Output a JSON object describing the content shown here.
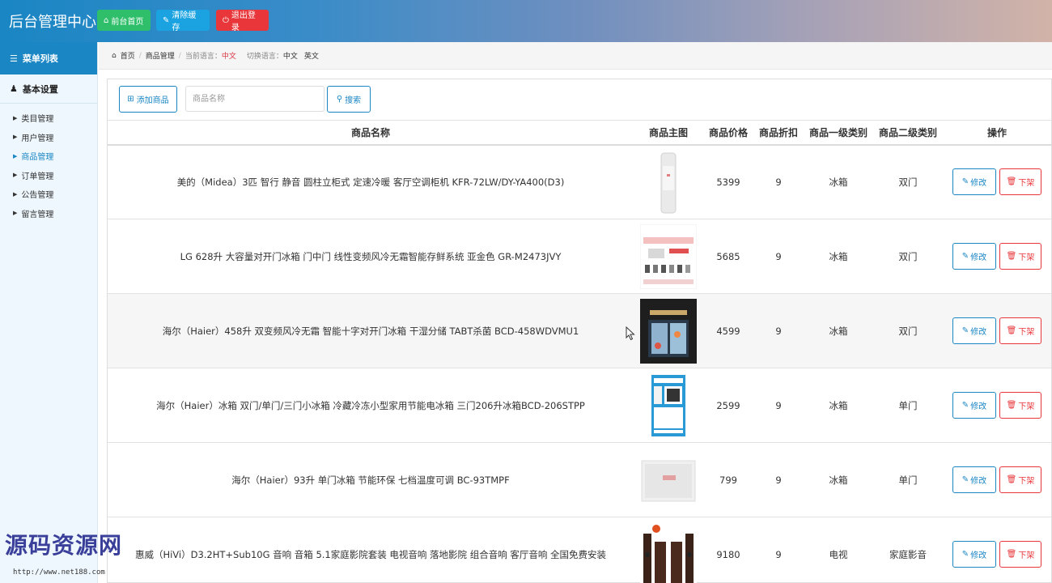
{
  "header": {
    "brand": "后台管理中心",
    "buttons": [
      {
        "icon": "home-icon",
        "label": "前台首页",
        "color": "#2fbf6b"
      },
      {
        "icon": "wrench-icon",
        "label": "清除缓存",
        "color": "#1aa3e0"
      },
      {
        "icon": "power-icon",
        "label": "退出登录",
        "color": "#e8363a"
      }
    ]
  },
  "sidebar": {
    "menu_title": "菜单列表",
    "section_title": "基本设置",
    "items": [
      {
        "label": "类目管理",
        "active": false
      },
      {
        "label": "用户管理",
        "active": false
      },
      {
        "label": "商品管理",
        "active": true
      },
      {
        "label": "订单管理",
        "active": false
      },
      {
        "label": "公告管理",
        "active": false
      },
      {
        "label": "留言管理",
        "active": false
      }
    ]
  },
  "breadcrumb": {
    "home": "首页",
    "current": "商品管理",
    "lang_label": "当前语言：",
    "lang_value": "中文",
    "switch_label": "切换语言：",
    "switch_zh": "中文",
    "switch_en": "英文"
  },
  "toolbar": {
    "add_label": "添加商品",
    "search_placeholder": "商品名称",
    "search_label": "搜索"
  },
  "table": {
    "headers": [
      "商品名称",
      "商品主图",
      "商品价格",
      "商品折扣",
      "商品一级类别",
      "商品二级类别",
      "操作"
    ],
    "edit_label": "修改",
    "off_label": "下架",
    "rows": [
      {
        "name": "美的（Midea）3匹 智行 静音 圆柱立柜式 定速冷暖 客厅空调柜机 KFR-72LW/DY-YA400(D3)",
        "price": "5399",
        "discount": "9",
        "cat1": "冰箱",
        "cat2": "双门"
      },
      {
        "name": "LG 628升 大容量对开门冰箱 门中门 线性变频风冷无霜智能存鲜系统 亚金色 GR-M2473JVY",
        "price": "5685",
        "discount": "9",
        "cat1": "冰箱",
        "cat2": "双门"
      },
      {
        "name": "海尔（Haier）458升 双变频风冷无霜 智能十字对开门冰箱 干湿分储 TABT杀菌 BCD-458WDVMU1",
        "price": "4599",
        "discount": "9",
        "cat1": "冰箱",
        "cat2": "双门"
      },
      {
        "name": "海尔（Haier）冰箱 双门/单门/三门小冰箱 冷藏冷冻小型家用节能电冰箱 三门206升冰箱BCD-206STPP",
        "price": "2599",
        "discount": "9",
        "cat1": "冰箱",
        "cat2": "单门"
      },
      {
        "name": "海尔（Haier）93升 单门冰箱 节能环保 七档温度可调 BC-93TMPF",
        "price": "799",
        "discount": "9",
        "cat1": "冰箱",
        "cat2": "单门"
      },
      {
        "name": "惠威（HiVi）D3.2HT+Sub10G 音响 音箱 5.1家庭影院套装 电视音响 落地影院 组合音响 客厅音响 全国免费安装",
        "price": "9180",
        "discount": "9",
        "cat1": "电视",
        "cat2": "家庭影音"
      }
    ]
  },
  "watermark": {
    "text": "源码资源网",
    "url": "http://www.net188.com"
  }
}
